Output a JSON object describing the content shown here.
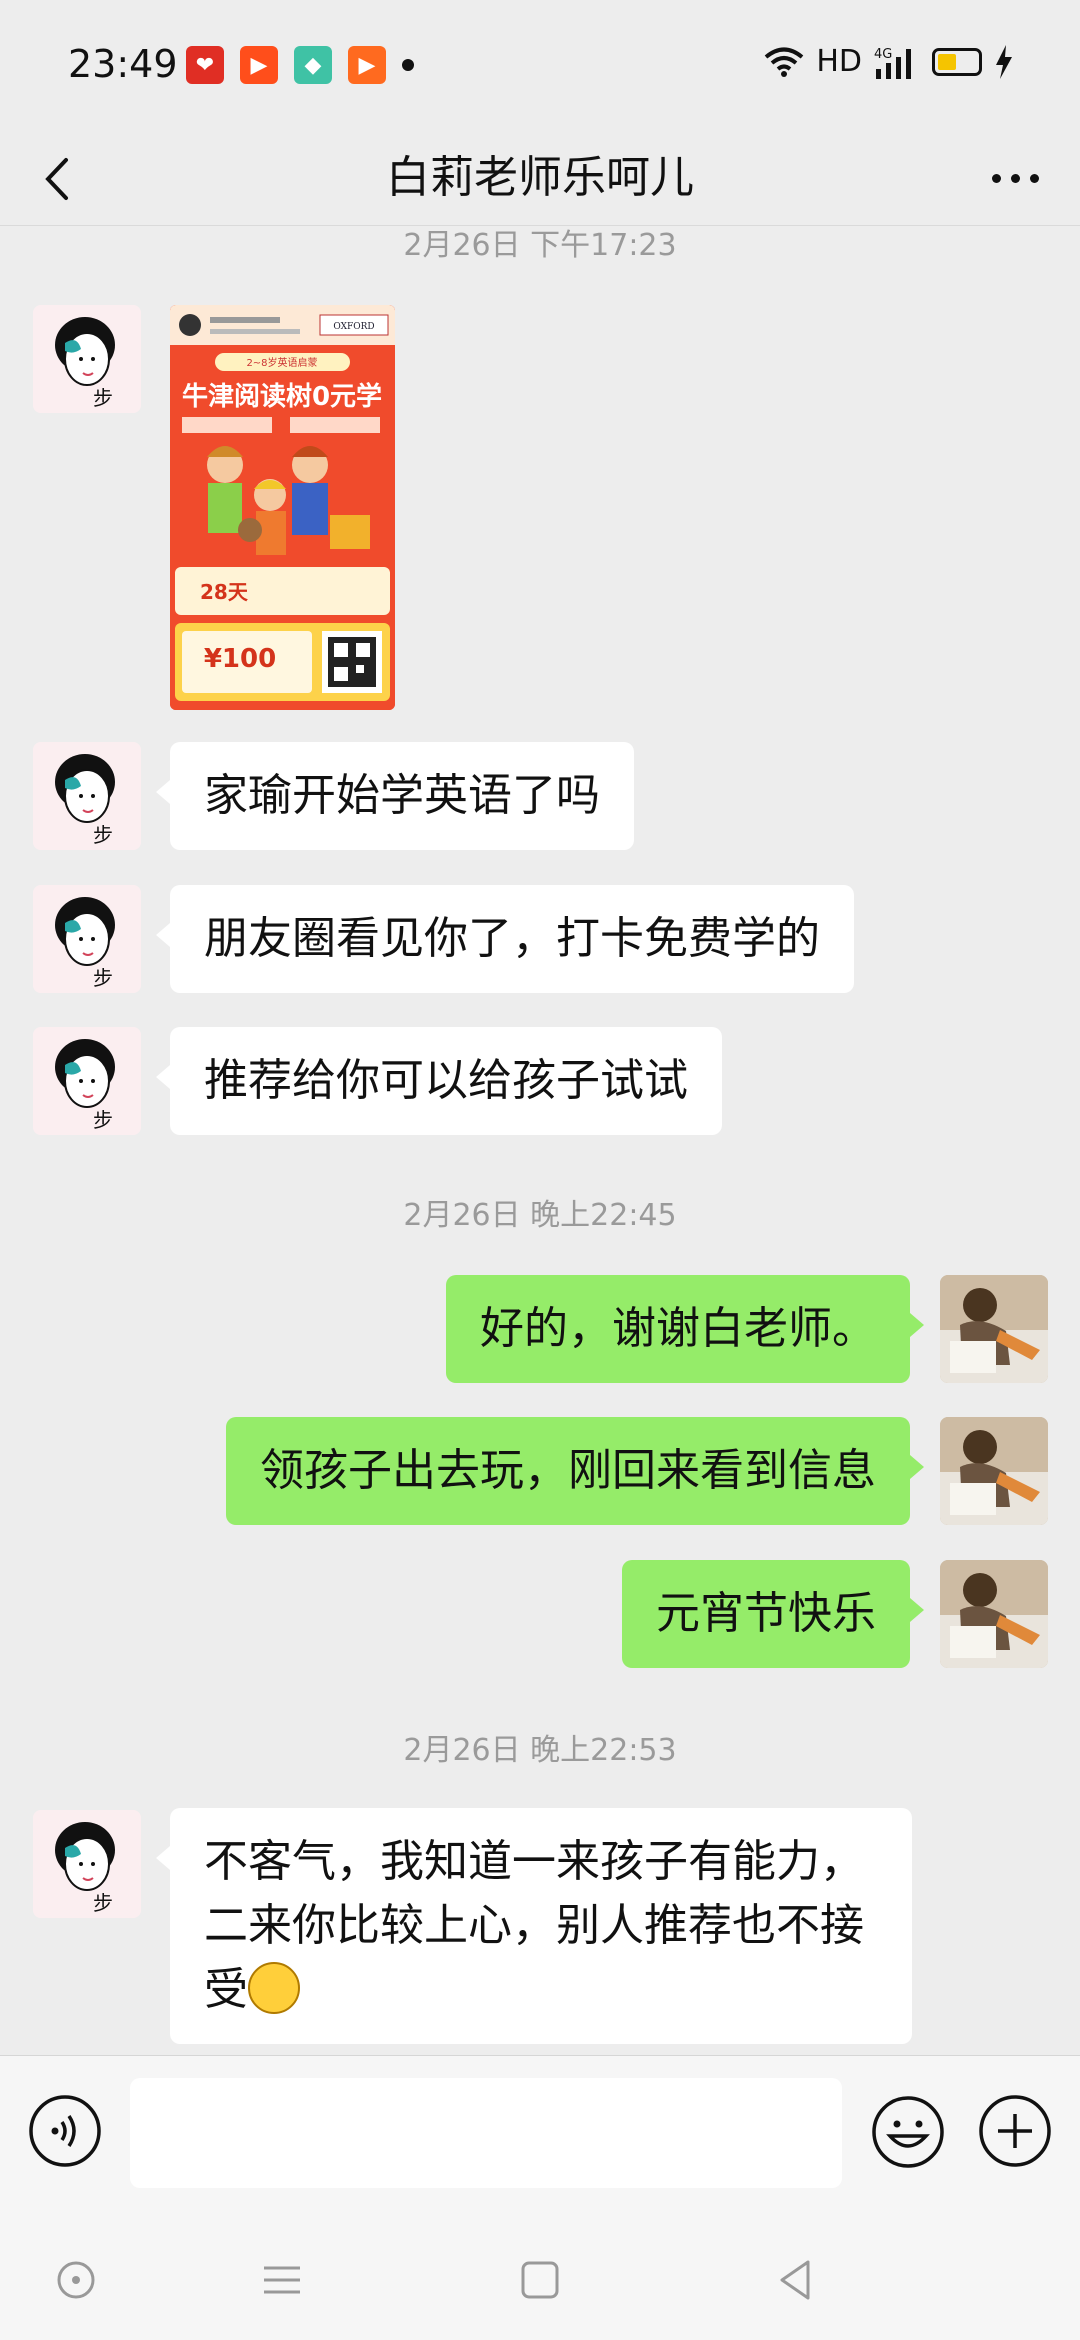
{
  "status_bar": {
    "time": "23:49",
    "hd_label": "HD",
    "network_label": "4G",
    "notification_icons": [
      "pinduoduo-icon",
      "kuaishou-lite-icon",
      "tiktok-lite-icon",
      "kuaishou-icon"
    ],
    "battery_level": 0.3
  },
  "header": {
    "title": "白莉老师乐呵儿"
  },
  "messages": {
    "ts1": "2月26日 下午17:23",
    "ts2": "2月26日 晚上22:45",
    "ts3": "2月26日 晚上22:53",
    "m1": "家瑜开始学英语了吗",
    "m2": "朋友圈看见你了，打卡免费学的",
    "m3": "推荐给你可以给孩子试试",
    "m4": "好的，谢谢白老师。",
    "m5": "领孩子出去玩，刚回来看到信息",
    "m6": "元宵节快乐",
    "m7": "不客气，我知道一来孩子有能力，二来你比较上心，别人推荐也不接受"
  },
  "poster": {
    "top_badge": "2~8岁英语启蒙",
    "brand": "OXFORD",
    "headline": "牛津阅读树0元学",
    "days": "28天",
    "coupon": "¥100"
  },
  "input": {
    "placeholder": ""
  },
  "colors": {
    "background": "#ededed",
    "self_bubble": "#95ec69",
    "other_bubble": "#ffffff",
    "poster": "#f04b2c"
  }
}
